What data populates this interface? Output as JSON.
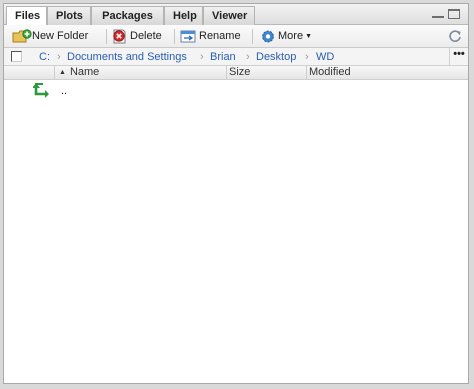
{
  "tabs": [
    "Files",
    "Plots",
    "Packages",
    "Help",
    "Viewer"
  ],
  "active_tab": "Files",
  "toolbar": {
    "new_folder": "New Folder",
    "delete": "Delete",
    "rename": "Rename",
    "more": "More"
  },
  "breadcrumb": [
    "C:",
    "Documents and Settings",
    "Brian",
    "Desktop",
    "WD"
  ],
  "breadcrumb_more": "•••",
  "columns": {
    "name": "Name",
    "size": "Size",
    "modified": "Modified"
  },
  "rows": [
    {
      "name": ".."
    }
  ],
  "colors": {
    "link": "#2a5db0",
    "up_arrow": "#2b9a3c"
  },
  "icons": {
    "new_folder": "new-folder-icon",
    "delete": "delete-icon",
    "rename": "rename-icon",
    "more": "gear-icon",
    "refresh": "refresh-icon",
    "up": "go-up-icon"
  }
}
